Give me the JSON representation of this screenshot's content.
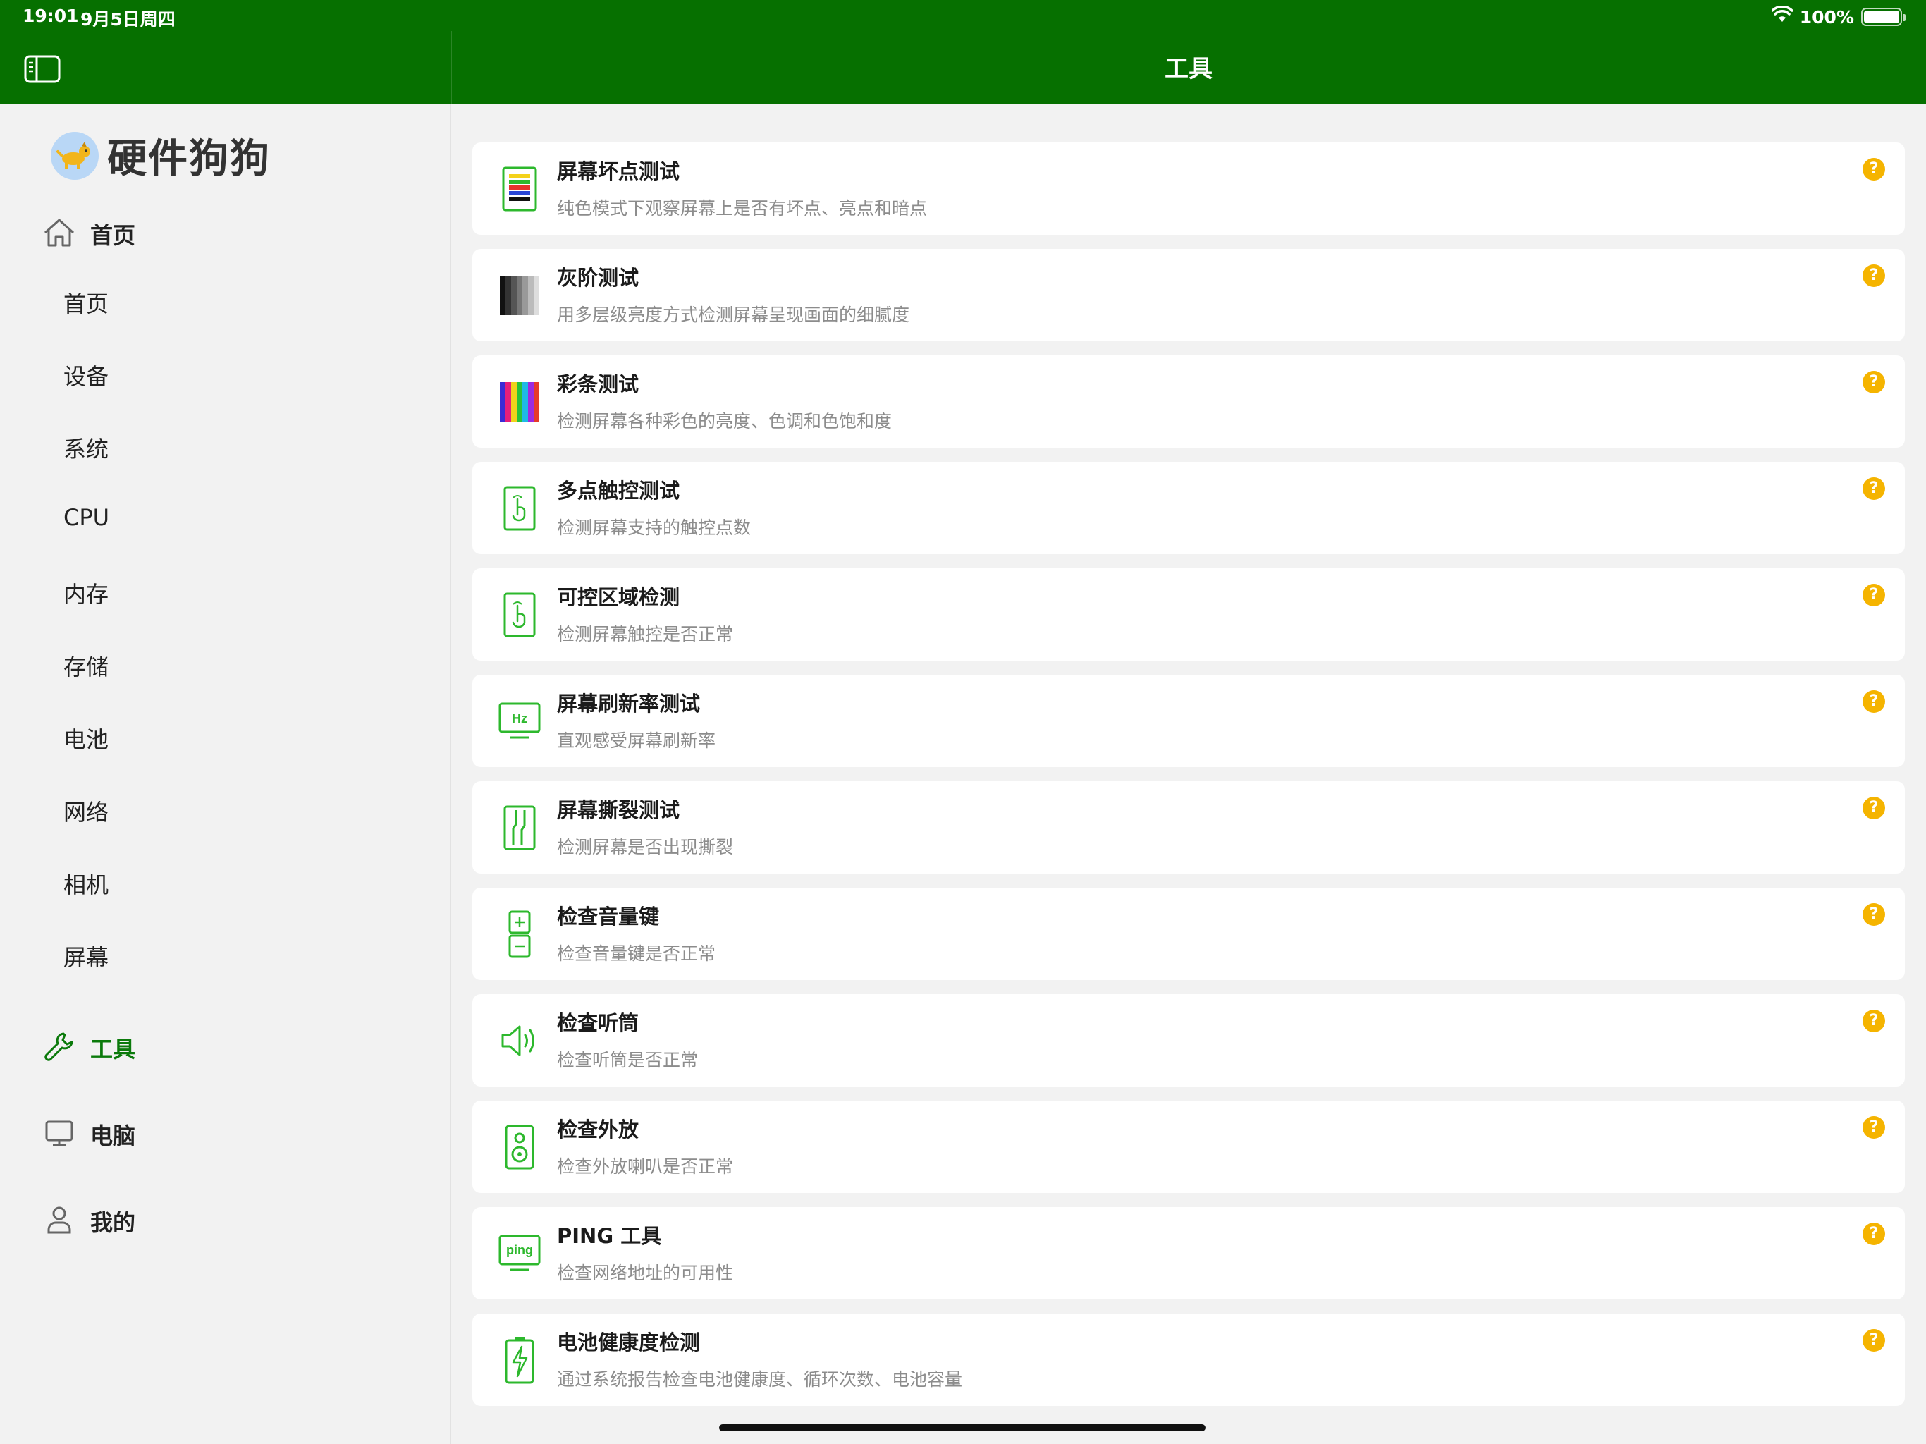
{
  "status_bar": {
    "time": "19:01",
    "date": "9月5日周四",
    "battery": "100%"
  },
  "header": {
    "title": "工具"
  },
  "sidebar": {
    "app_name": "硬件狗狗",
    "home_group": "首页",
    "sub_items": [
      "首页",
      "设备",
      "系统",
      "CPU",
      "内存",
      "存储",
      "电池",
      "网络",
      "相机",
      "屏幕"
    ],
    "tools": "工具",
    "computer": "电脑",
    "mine": "我的"
  },
  "tools": [
    {
      "title": "屏幕坏点测试",
      "desc": "纯色模式下观察屏幕上是否有坏点、亮点和暗点",
      "icon": "dead-pixel-icon"
    },
    {
      "title": "灰阶测试",
      "desc": "用多层级亮度方式检测屏幕呈现画面的细腻度",
      "icon": "grayscale-icon"
    },
    {
      "title": "彩条测试",
      "desc": "检测屏幕各种彩色的亮度、色调和色饱和度",
      "icon": "color-bars-icon"
    },
    {
      "title": "多点触控测试",
      "desc": "检测屏幕支持的触控点数",
      "icon": "multi-touch-icon"
    },
    {
      "title": "可控区域检测",
      "desc": "检测屏幕触控是否正常",
      "icon": "touch-area-icon"
    },
    {
      "title": "屏幕刷新率测试",
      "desc": "直观感受屏幕刷新率",
      "icon": "refresh-rate-icon",
      "icon_text": "Hz"
    },
    {
      "title": "屏幕撕裂测试",
      "desc": "检测屏幕是否出现撕裂",
      "icon": "screen-tearing-icon"
    },
    {
      "title": "检查音量键",
      "desc": "检查音量键是否正常",
      "icon": "volume-keys-icon"
    },
    {
      "title": "检查听筒",
      "desc": "检查听筒是否正常",
      "icon": "earpiece-icon"
    },
    {
      "title": "检查外放",
      "desc": "检查外放喇叭是否正常",
      "icon": "loudspeaker-icon"
    },
    {
      "title": "PING 工具",
      "desc": "检查网络地址的可用性",
      "icon": "ping-icon",
      "icon_text": "ping"
    },
    {
      "title": "电池健康度检测",
      "desc": "通过系统报告检查电池健康度、循环次数、电池容量",
      "icon": "battery-health-icon"
    }
  ],
  "help_symbol": "?",
  "colors": {
    "brand": "#067000",
    "accent": "#2db82d",
    "help": "#f5b400"
  }
}
